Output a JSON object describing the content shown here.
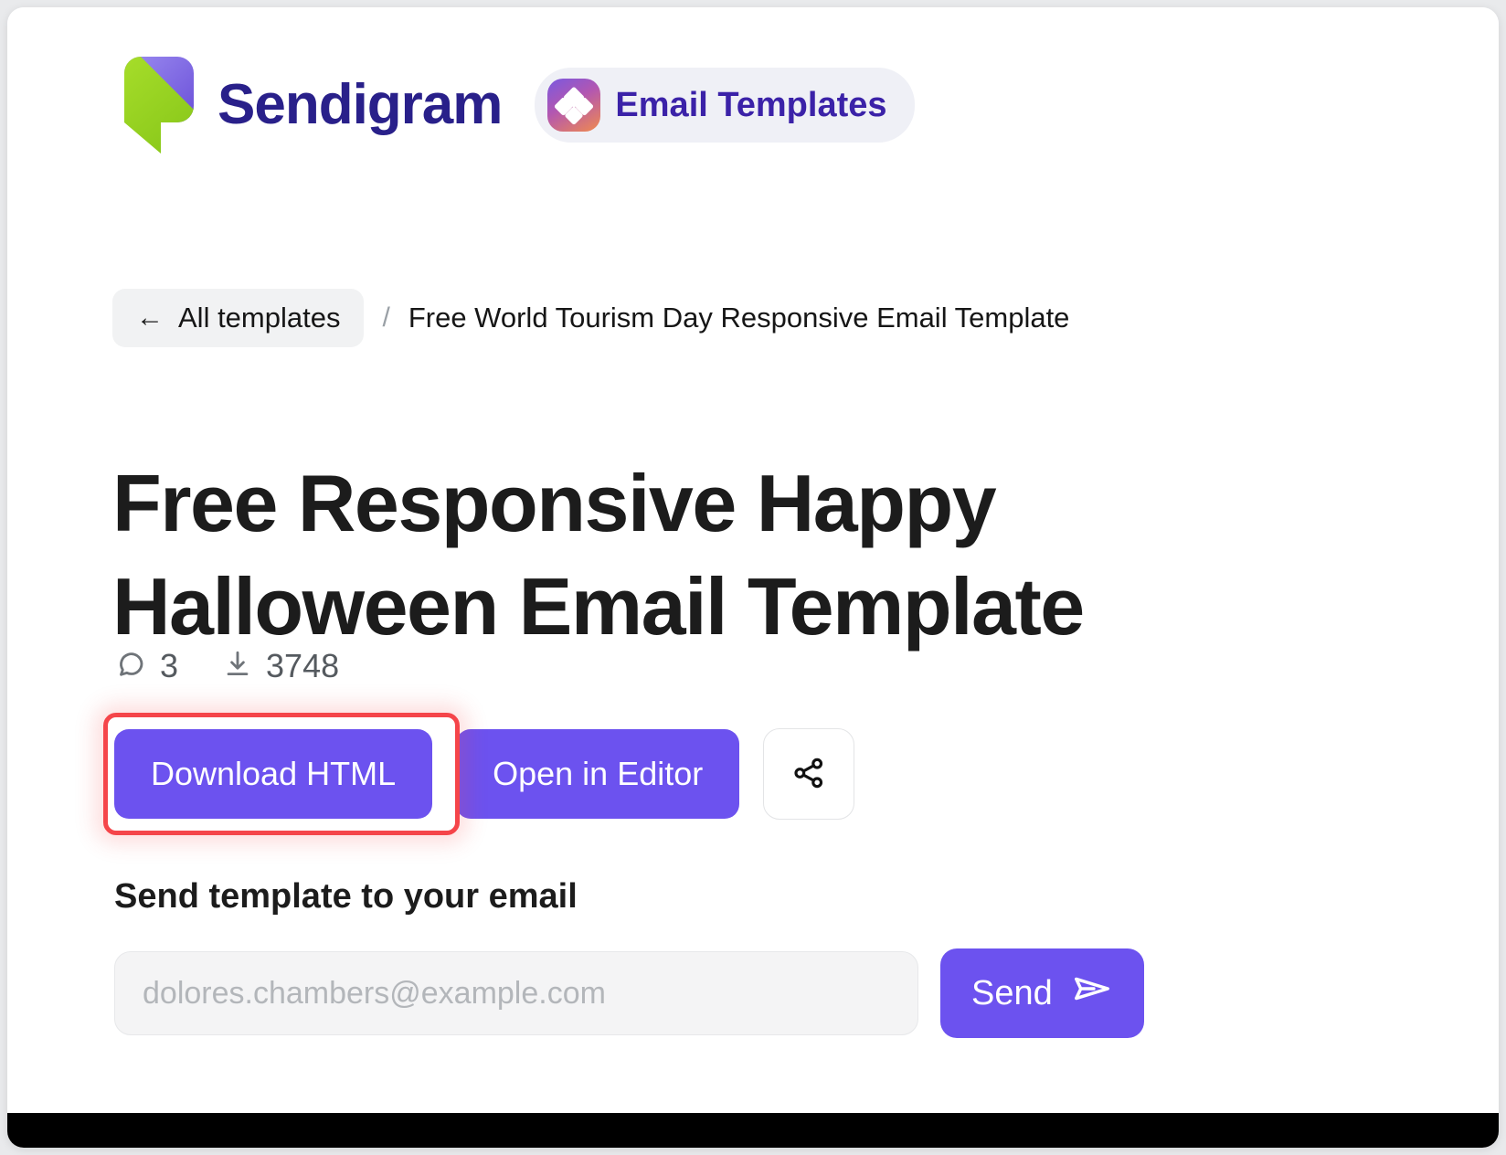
{
  "brand": {
    "name": "Sendigram",
    "logo_icon": "sendigram-logo-icon",
    "badge": {
      "label": "Email Templates",
      "icon": "diamonds-grid-icon",
      "icon_gradient_from": "#7a58e0",
      "icon_gradient_to": "#f08a4e"
    }
  },
  "breadcrumb": {
    "back_icon": "arrow-left-icon",
    "back_label": "All templates",
    "separator": "/",
    "current": "Free World Tourism Day Responsive Email Template"
  },
  "page": {
    "title": "Free Responsive Happy Halloween Email Template"
  },
  "stats": {
    "comments_icon": "comment-bubble-icon",
    "comments": "3",
    "downloads_icon": "download-icon",
    "downloads": "3748"
  },
  "actions": {
    "download_label": "Download HTML",
    "open_editor_label": "Open in Editor",
    "share_icon": "share-network-icon",
    "highlighted": "download-html-button",
    "highlight_color": "#f5454a"
  },
  "email_form": {
    "label": "Send template to your email",
    "placeholder": "dolores.chambers@example.com",
    "value": "",
    "send_label": "Send",
    "send_icon": "paper-plane-icon"
  },
  "theme": {
    "accent": "#6c52ef",
    "brand_text": "#29208a",
    "badge_bg": "#eff0f6",
    "page_bg": "#ffffff",
    "surround_bg": "#e9eaec"
  }
}
